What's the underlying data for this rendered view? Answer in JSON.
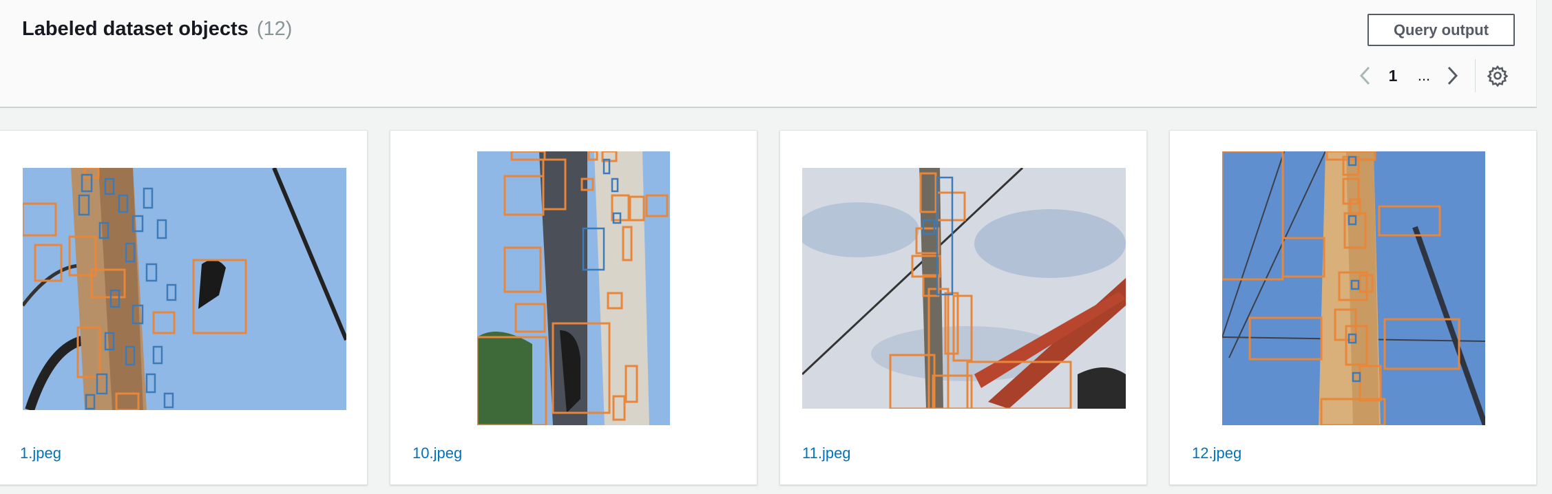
{
  "header": {
    "title": "Labeled dataset objects",
    "count": "(12)",
    "query_button": "Query output"
  },
  "pagination": {
    "current_page": "1",
    "ellipsis": "..."
  },
  "colors": {
    "box_orange": "#e8863a",
    "box_blue": "#3d7ab8",
    "link": "#0073bb"
  },
  "cards": [
    {
      "filename": "1.jpeg"
    },
    {
      "filename": "10.jpeg"
    },
    {
      "filename": "11.jpeg"
    },
    {
      "filename": "12.jpeg"
    }
  ]
}
